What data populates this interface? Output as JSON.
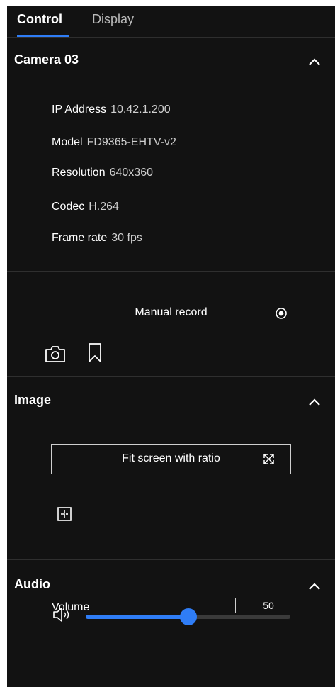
{
  "tabs": {
    "control": "Control",
    "display": "Display"
  },
  "camera": {
    "title": "Camera 03",
    "ip_label": "IP Address",
    "ip_value": "10.42.1.200",
    "model_label": "Model",
    "model_value": "FD9365-EHTV-v2",
    "resolution_label": "Resolution",
    "resolution_value": "640x360",
    "codec_label": "Codec",
    "codec_value": "H.264",
    "framerate_label": "Frame rate",
    "framerate_value": "30 fps",
    "manual_record_label": "Manual record"
  },
  "image": {
    "title": "Image",
    "fit_label": "Fit screen with ratio"
  },
  "audio": {
    "title": "Audio",
    "volume_label": "Volume",
    "volume_value": "50",
    "volume_fraction": 0.5
  },
  "colors": {
    "accent": "#2f7df6",
    "background": "#121212"
  },
  "icons": {
    "collapse": "chevron-up-icon",
    "record": "record-icon",
    "snapshot": "camera-icon",
    "bookmark": "bookmark-icon",
    "fit": "expand-arrows-icon",
    "crop": "crop-icon",
    "volume": "speaker-icon"
  }
}
